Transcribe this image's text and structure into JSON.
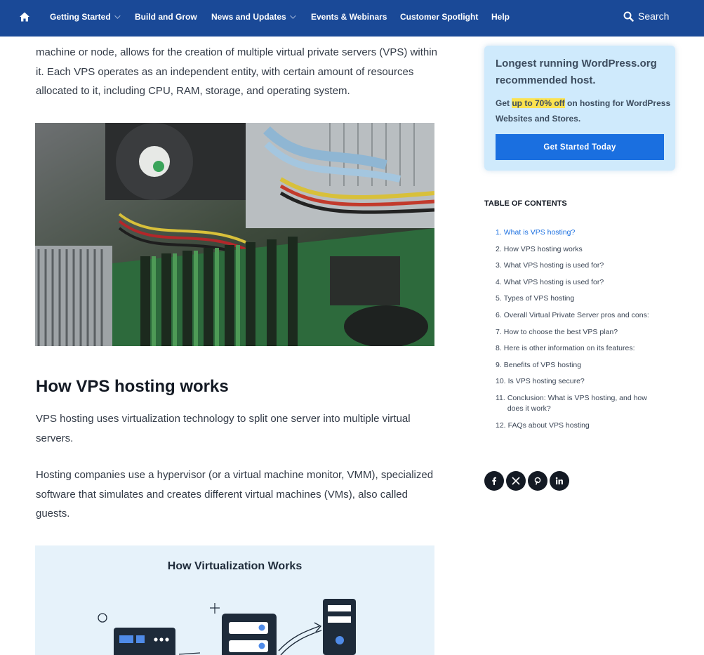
{
  "nav": {
    "home_icon": "home-icon",
    "items": [
      {
        "label": "Getting Started",
        "dropdown": true
      },
      {
        "label": "Build and Grow",
        "dropdown": false
      },
      {
        "label": "News and Updates",
        "dropdown": true
      },
      {
        "label": "Events & Webinars",
        "dropdown": false
      },
      {
        "label": "Customer Spotlight",
        "dropdown": false
      },
      {
        "label": "Help",
        "dropdown": false
      }
    ],
    "search_label": "Search"
  },
  "article": {
    "intro_paragraph": "machine or node, allows for the creation of multiple virtual private servers (VPS) within it. Each VPS operates as an independent entity, with certain amount of resources allocated to it, including CPU, RAM, storage, and operating system.",
    "section_heading": "How VPS hosting works",
    "paragraph_2": "VPS hosting uses virtualization technology to split one server into multiple virtual servers.",
    "paragraph_3": "Hosting companies use a hypervisor (or a virtual machine monitor, VMM), specialized software that simulates and creates different virtual machines (VMs), also called guests.",
    "diagram_title": "How Virtualization Works"
  },
  "promo": {
    "title": "Longest running WordPress.org recommended host.",
    "text_before": "Get ",
    "highlight": "up to 70% off",
    "text_after": " on hosting for WordPress Websites and Stores.",
    "button_label": "Get Started Today"
  },
  "toc": {
    "heading": "TABLE OF CONTENTS",
    "items": [
      {
        "num": "1.",
        "label": "What is VPS hosting?",
        "active": true
      },
      {
        "num": "2.",
        "label": "How VPS hosting works",
        "active": false
      },
      {
        "num": "3.",
        "label": "What VPS hosting is used for?",
        "active": false
      },
      {
        "num": "4.",
        "label": "What VPS hosting is used for?",
        "active": false
      },
      {
        "num": "5.",
        "label": "Types of VPS hosting",
        "active": false
      },
      {
        "num": "6.",
        "label": "Overall Virtual Private Server pros and cons:",
        "active": false
      },
      {
        "num": "7.",
        "label": "How to choose the best VPS plan?",
        "active": false
      },
      {
        "num": "8.",
        "label": "Here is other information on its features:",
        "active": false
      },
      {
        "num": "9.",
        "label": "Benefits of VPS hosting",
        "active": false
      },
      {
        "num": "10.",
        "label": "Is VPS hosting secure?",
        "active": false
      },
      {
        "num": "11.",
        "label": "Conclusion: What is VPS hosting, and how does it work?",
        "active": false
      },
      {
        "num": "12.",
        "label": "FAQs about VPS hosting",
        "active": false
      }
    ]
  },
  "social": {
    "icons": [
      "facebook-icon",
      "x-icon",
      "pinterest-icon",
      "linkedin-icon"
    ]
  },
  "colors": {
    "nav_bg": "#1a4997",
    "promo_bg": "#cfeafc",
    "button_bg": "#1a6fe0",
    "highlight": "#fbe24f",
    "active_link": "#1a6fe0"
  }
}
